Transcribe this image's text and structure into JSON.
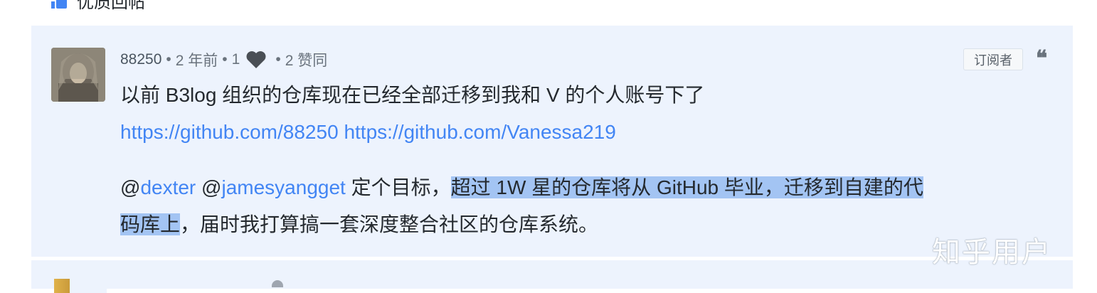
{
  "section": {
    "title": "优质回帖",
    "icon": "thumbs-up-icon"
  },
  "post": {
    "author": "88250",
    "dot1": "•",
    "time": "2 年前",
    "dot2": "•",
    "likes": "1",
    "heart_icon": "heart-icon",
    "dot3": "•",
    "upvotes": "2 赞同",
    "badge": "订阅者",
    "quote_icon": "quote-icon",
    "quote_glyph": "❝",
    "line1": "以前 B3log 组织的仓库现在已经全部迁移到我和 V 的个人账号下了",
    "link1": "https://github.com/88250",
    "link2": "https://github.com/Vanessa219",
    "at1": "@",
    "mention1": "dexter",
    "at2": "@",
    "mention2": "jamesyangget",
    "text_before_highlight": " 定个目标，",
    "highlight_part1": "超过 1W 星的仓库将从 GitHub 毕业，迁移到自建的代",
    "highlight_part2": "码库上",
    "text_after_highlight": "，届时我打算搞一套深度整合社区的仓库系统。"
  },
  "watermark": "知乎用户",
  "colors": {
    "panel": "#edf3fd",
    "link": "#4285f4",
    "highlight": "#a3c4f3",
    "muted": "#6a737d"
  }
}
